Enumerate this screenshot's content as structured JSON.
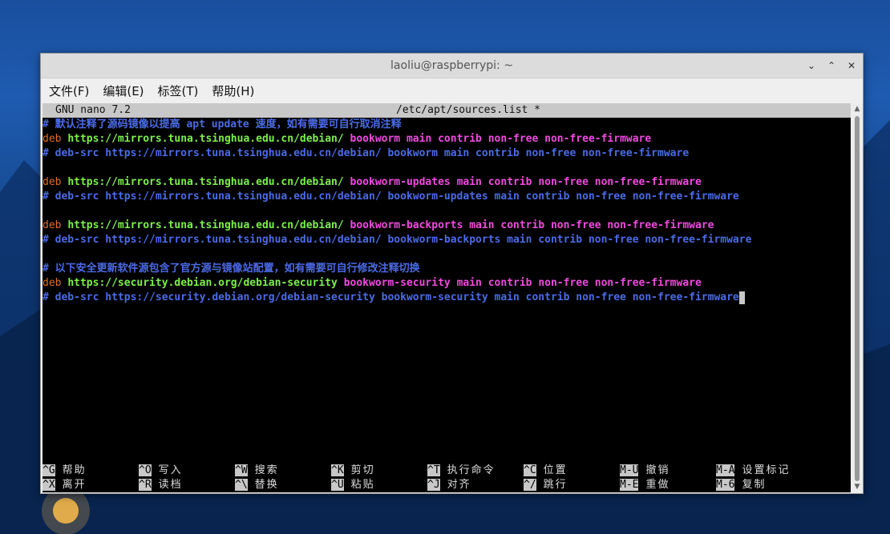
{
  "window": {
    "title": "laoliu@raspberrypi: ~",
    "controls": [
      "chevron-down",
      "chevron-up",
      "close"
    ]
  },
  "menu": [
    "文件(F)",
    "编辑(E)",
    "标签(T)",
    "帮助(H)"
  ],
  "nano": {
    "version": "GNU nano 7.2",
    "file": "/etc/apt/sources.list *"
  },
  "lines": [
    {
      "type": "comment",
      "text": "# 默认注释了源码镜像以提高 apt update 速度，如有需要可自行取消注释"
    },
    {
      "type": "deb",
      "kw": "deb",
      "url": "https://mirrors.tuna.tsinghua.edu.cn/debian/",
      "suite": "bookworm",
      "comps": "main contrib non-free non-free-firmware"
    },
    {
      "type": "comment",
      "text": "# deb-src https://mirrors.tuna.tsinghua.edu.cn/debian/ bookworm main contrib non-free non-free-firmware"
    },
    {
      "type": "blank"
    },
    {
      "type": "deb",
      "kw": "deb",
      "url": "https://mirrors.tuna.tsinghua.edu.cn/debian/",
      "suite": "bookworm-updates",
      "comps": "main contrib non-free non-free-firmware"
    },
    {
      "type": "comment",
      "text": "# deb-src https://mirrors.tuna.tsinghua.edu.cn/debian/ bookworm-updates main contrib non-free non-free-firmware"
    },
    {
      "type": "blank"
    },
    {
      "type": "deb",
      "kw": "deb",
      "url": "https://mirrors.tuna.tsinghua.edu.cn/debian/",
      "suite": "bookworm-backports",
      "comps": "main contrib non-free non-free-firmware"
    },
    {
      "type": "comment",
      "text": "# deb-src https://mirrors.tuna.tsinghua.edu.cn/debian/ bookworm-backports main contrib non-free non-free-firmware"
    },
    {
      "type": "blank"
    },
    {
      "type": "comment",
      "text": "# 以下安全更新软件源包含了官方源与镜像站配置，如有需要可自行修改注释切换"
    },
    {
      "type": "deb",
      "kw": "deb",
      "url": "https://security.debian.org/debian-security",
      "suite": "bookworm-security",
      "comps": "main contrib non-free non-free-firmware"
    },
    {
      "type": "comment",
      "text": "# deb-src https://security.debian.org/debian-security bookworm-security main contrib non-free non-free-firmware",
      "cursor": true
    }
  ],
  "shortcuts_row1": [
    {
      "key": "^G",
      "label": "帮助"
    },
    {
      "key": "^O",
      "label": "写入"
    },
    {
      "key": "^W",
      "label": "搜索"
    },
    {
      "key": "^K",
      "label": "剪切"
    },
    {
      "key": "^T",
      "label": "执行命令"
    },
    {
      "key": "^C",
      "label": "位置"
    },
    {
      "key": "M-U",
      "label": "撤销"
    },
    {
      "key": "M-A",
      "label": "设置标记"
    }
  ],
  "shortcuts_row2": [
    {
      "key": "^X",
      "label": "离开"
    },
    {
      "key": "^R",
      "label": "读档"
    },
    {
      "key": "^\\",
      "label": "替换"
    },
    {
      "key": "^U",
      "label": "粘贴"
    },
    {
      "key": "^J",
      "label": "对齐"
    },
    {
      "key": "^/",
      "label": "跳行"
    },
    {
      "key": "M-E",
      "label": "重做"
    },
    {
      "key": "M-6",
      "label": "复制"
    }
  ]
}
